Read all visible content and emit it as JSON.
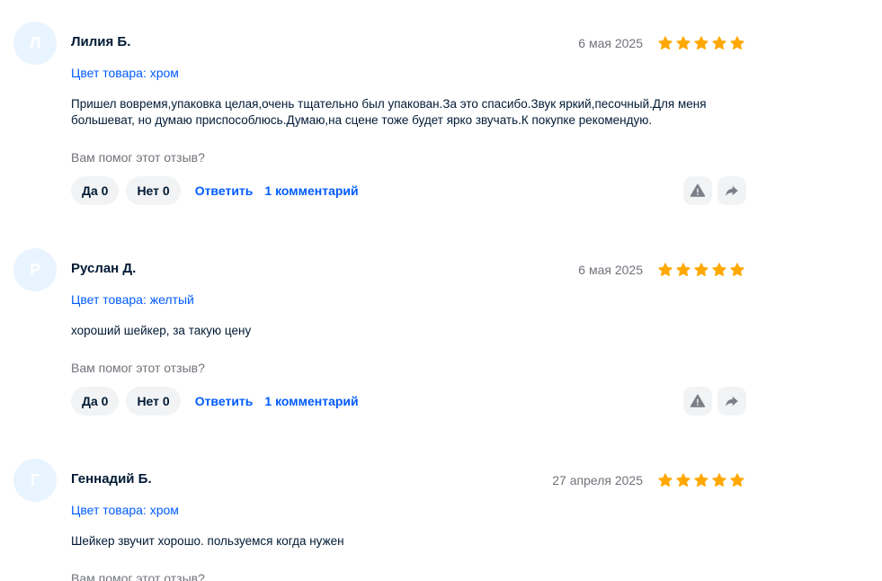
{
  "colors": {
    "accent": "#005bff",
    "star": "#ffa800",
    "avatar_bg": "#e8f4ff",
    "muted": "#70737a"
  },
  "reviews": [
    {
      "initial": "Л",
      "author": "Лилия Б.",
      "date": "6 мая 2025",
      "rating": 5,
      "variant": "Цвет товара: хром",
      "text": "Пришел вовремя,упаковка целая,очень тщательно был упакован.За это спасибо.Звук яркий,песочный.Для меня большеват, но думаю приспособлюсь.Думаю,на сцене тоже будет ярко звучать.К покупке рекомендую.",
      "helpful_question": "Вам помог этот отзыв?",
      "yes_label": "Да 0",
      "no_label": "Нет 0",
      "reply_label": "Ответить",
      "comments_label": "1 комментарий",
      "report_icon": "warning-icon",
      "share_icon": "share-icon"
    },
    {
      "initial": "Р",
      "author": "Руслан Д.",
      "date": "6 мая 2025",
      "rating": 5,
      "variant": "Цвет товара: желтый",
      "text": "хороший шейкер, за такую цену",
      "helpful_question": "Вам помог этот отзыв?",
      "yes_label": "Да 0",
      "no_label": "Нет 0",
      "reply_label": "Ответить",
      "comments_label": "1 комментарий",
      "report_icon": "warning-icon",
      "share_icon": "share-icon"
    },
    {
      "initial": "Г",
      "author": "Геннадий Б.",
      "date": "27 апреля 2025",
      "rating": 5,
      "variant": "Цвет товара: хром",
      "text": "Шейкер звучит хорошо. пользуемся когда нужен",
      "helpful_question": "Вам помог этот отзыв?"
    }
  ]
}
